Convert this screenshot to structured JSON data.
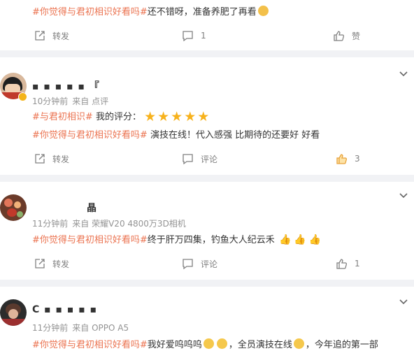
{
  "post0": {
    "text_tag": "#你觉得与君初相识好看吗#",
    "text_body": "还不错呀，准备养肥了再看",
    "repost_label": "转发",
    "comment_count": "1",
    "like_label": "赞"
  },
  "post1": {
    "name": "▪ ▪ ▪ ▪ ▪ 『",
    "time": "10分钟前",
    "source": "来自 点评",
    "rating_tag": "#与君初相识#",
    "rating_label": "我的评分：",
    "stars": "★★★★★",
    "text_tag": "#你觉得与君初相识好看吗#",
    "text_body": "演技在线！代入感强 比期待的还要好 好看",
    "repost_label": "转发",
    "comment_label": "评论",
    "like_count": "3"
  },
  "post2": {
    "name": "晶",
    "time": "11分钟前",
    "source": "来自 荣耀V20 4800万3D相机",
    "text_tag": "#你觉得与君初相识好看吗#",
    "text_body": "终于肝万四集，钓鱼大人纪云禾",
    "repost_label": "转发",
    "comment_label": "评论",
    "like_count": "1"
  },
  "post3": {
    "name": "C ▪ ▪ ▪ ▪ ▪",
    "time": "11分钟前",
    "source": "来自 OPPO A5",
    "text_tag": "#你觉得与君初相识好看吗#",
    "text_body1": "我好爱呜呜呜",
    "text_body2": "，全员演技在线",
    "text_body3": "，今年追的第一部"
  },
  "colors": {
    "accent": "#eb7350",
    "star": "#f7b21c",
    "separator": "#f1f2f5"
  }
}
